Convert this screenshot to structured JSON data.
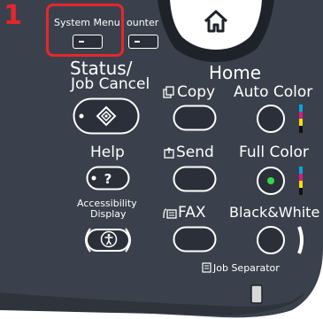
{
  "step_number": "1",
  "system_menu": {
    "label": "System Menu"
  },
  "counter": {
    "label": "ounter"
  },
  "status_job_cancel": {
    "line1": "Status/",
    "line2": "Job Cancel"
  },
  "home": {
    "label": "Home"
  },
  "copy": {
    "label": "Copy"
  },
  "send": {
    "label": "Send"
  },
  "fax": {
    "label": "FAX"
  },
  "auto_color": {
    "label": "Auto Color"
  },
  "full_color": {
    "label": "Full Color"
  },
  "black_white": {
    "label": "Black&White"
  },
  "help": {
    "label": "Help",
    "key": "?"
  },
  "accessibility_display": {
    "line1": "Accessibility",
    "line2": "Display"
  },
  "job_separator": {
    "label": "Job Separator"
  },
  "icons": [
    "home-icon",
    "diamond-icon",
    "help-icon",
    "accessibility-icon",
    "copy-icon",
    "send-icon",
    "fax-icon",
    "job-separator-icon"
  ],
  "colors": {
    "panel": "#3a414c",
    "panel_dark": "#23272f",
    "highlight": "#e8262b",
    "led_green": "#39d64b",
    "cyan": "#00a8e0",
    "magenta": "#e0177f",
    "yellow": "#f5e000",
    "black": "#111111"
  }
}
